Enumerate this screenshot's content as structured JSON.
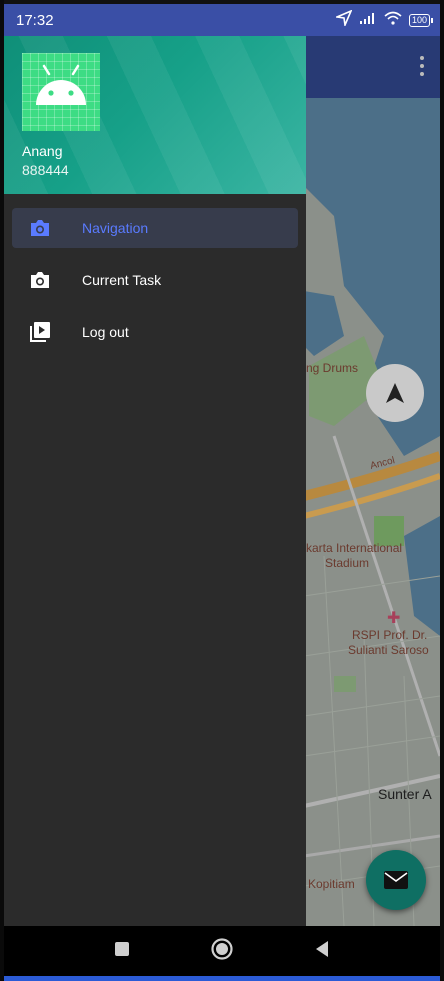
{
  "status_bar": {
    "time": "17:32",
    "icons": [
      "navigation-arrow-icon",
      "signal-icon",
      "wifi-icon",
      "battery-icon"
    ],
    "battery": "100"
  },
  "drawer": {
    "user_name": "Anang",
    "user_id": "888444",
    "items": [
      {
        "label": "Navigation",
        "icon": "camera-icon",
        "active": true
      },
      {
        "label": "Current Task",
        "icon": "camera-icon",
        "active": false
      },
      {
        "label": "Log out",
        "icon": "video-library-icon",
        "active": false
      }
    ]
  },
  "map": {
    "labels": {
      "drums": "ng Drums",
      "road": "Ancol",
      "stadium_1": "karta International",
      "stadium_2": "Stadium",
      "hospital_1": "RSPI Prof. Dr.",
      "hospital_2": "Sulianti Saroso",
      "area": "Sunter A",
      "cafe": "Kopitiam"
    }
  },
  "colors": {
    "status_bar": "#3a4fa6",
    "header_gradient_start": "#0f8f78",
    "drawer_bg": "#2b2b2b",
    "active_item": "#5a7bff",
    "fab": "#0f6f63"
  }
}
